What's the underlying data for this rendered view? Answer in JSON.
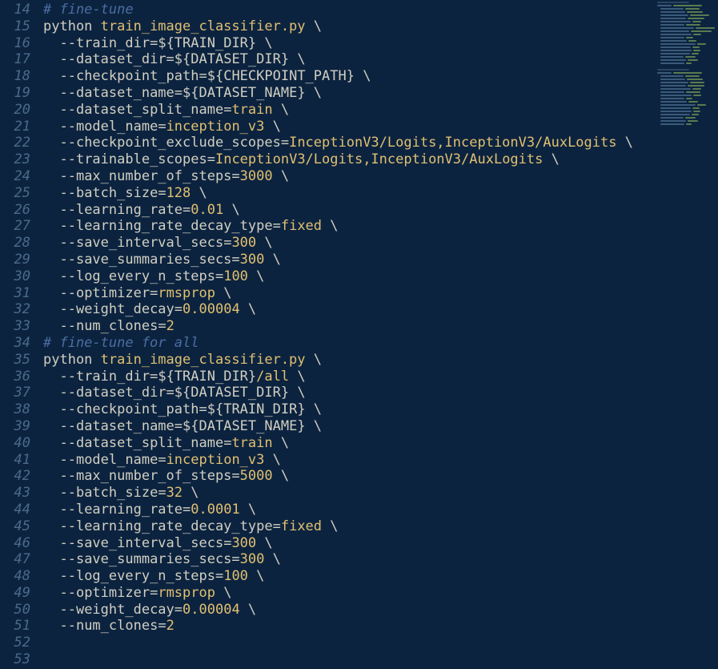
{
  "editor": {
    "first_line_number": 14,
    "lines": [
      {
        "type": "comment",
        "text": "# fine-tune"
      },
      {
        "type": "cmd",
        "cmd": "python",
        "exe": "train_image_classifier.py",
        "cont": true
      },
      {
        "type": "flag",
        "flag": "--train_dir",
        "val": "${TRAIN_DIR}",
        "cont": true
      },
      {
        "type": "flag",
        "flag": "--dataset_dir",
        "val": "${DATASET_DIR}",
        "cont": true
      },
      {
        "type": "flag",
        "flag": "--checkpoint_path",
        "val": "${CHECKPOINT_PATH}",
        "cont": true
      },
      {
        "type": "flag",
        "flag": "--dataset_name",
        "val": "${DATASET_NAME}",
        "cont": true
      },
      {
        "type": "flagval",
        "flag": "--dataset_split_name",
        "val": "train",
        "cont": true
      },
      {
        "type": "flagval",
        "flag": "--model_name",
        "val": "inception_v3",
        "cont": true
      },
      {
        "type": "flagval",
        "flag": "--checkpoint_exclude_scopes",
        "val": "InceptionV3/Logits,InceptionV3/AuxLogits",
        "cont": true
      },
      {
        "type": "flagval",
        "flag": "--trainable_scopes",
        "val": "InceptionV3/Logits,InceptionV3/AuxLogits",
        "cont": true
      },
      {
        "type": "flagnum",
        "flag": "--max_number_of_steps",
        "val": "3000",
        "cont": true
      },
      {
        "type": "flagnum",
        "flag": "--batch_size",
        "val": "128",
        "cont": true
      },
      {
        "type": "flagnum",
        "flag": "--learning_rate",
        "val": "0.01",
        "cont": true
      },
      {
        "type": "flagval",
        "flag": "--learning_rate_decay_type",
        "val": "fixed",
        "cont": true
      },
      {
        "type": "flagnum",
        "flag": "--save_interval_secs",
        "val": "300",
        "cont": true
      },
      {
        "type": "flagnum",
        "flag": "--save_summaries_secs",
        "val": "300",
        "cont": true
      },
      {
        "type": "flagnum",
        "flag": "--log_every_n_steps",
        "val": "100",
        "cont": true
      },
      {
        "type": "flagval",
        "flag": "--optimizer",
        "val": "rmsprop",
        "cont": true
      },
      {
        "type": "flagnum",
        "flag": "--weight_decay",
        "val": "0.00004",
        "cont": true
      },
      {
        "type": "flagnum",
        "flag": "--num_clones",
        "val": "2",
        "cont": false
      },
      {
        "type": "blank"
      },
      {
        "type": "comment",
        "text": "# fine-tune for all"
      },
      {
        "type": "cmd",
        "cmd": "python",
        "exe": "train_image_classifier.py",
        "cont": true
      },
      {
        "type": "flagmix",
        "flag": "--train_dir",
        "val": "${TRAIN_DIR}",
        "suffix": "/all",
        "cont": true
      },
      {
        "type": "flag",
        "flag": "--dataset_dir",
        "val": "${DATASET_DIR}",
        "cont": true
      },
      {
        "type": "flag",
        "flag": "--checkpoint_path",
        "val": "${TRAIN_DIR}",
        "cont": true
      },
      {
        "type": "flag",
        "flag": "--dataset_name",
        "val": "${DATASET_NAME}",
        "cont": true
      },
      {
        "type": "flagval",
        "flag": "--dataset_split_name",
        "val": "train",
        "cont": true
      },
      {
        "type": "flagval",
        "flag": "--model_name",
        "val": "inception_v3",
        "cont": true
      },
      {
        "type": "flagnum",
        "flag": "--max_number_of_steps",
        "val": "5000",
        "cont": true
      },
      {
        "type": "flagnum",
        "flag": "--batch_size",
        "val": "32",
        "cont": true
      },
      {
        "type": "flagnum",
        "flag": "--learning_rate",
        "val": "0.0001",
        "cont": true
      },
      {
        "type": "flagval",
        "flag": "--learning_rate_decay_type",
        "val": "fixed",
        "cont": true
      },
      {
        "type": "flagnum",
        "flag": "--save_interval_secs",
        "val": "300",
        "cont": true
      },
      {
        "type": "flagnum",
        "flag": "--save_summaries_secs",
        "val": "300",
        "cont": true
      },
      {
        "type": "flagnum",
        "flag": "--log_every_n_steps",
        "val": "100",
        "cont": true
      },
      {
        "type": "flagval",
        "flag": "--optimizer",
        "val": "rmsprop",
        "cont": true
      },
      {
        "type": "flagnum",
        "flag": "--weight_decay",
        "val": "0.00004",
        "cont": true
      },
      {
        "type": "flagnum",
        "flag": "--num_clones",
        "val": "2",
        "cont": false
      },
      {
        "type": "blank"
      }
    ],
    "indent": "  ",
    "minimap_rows": 40
  }
}
